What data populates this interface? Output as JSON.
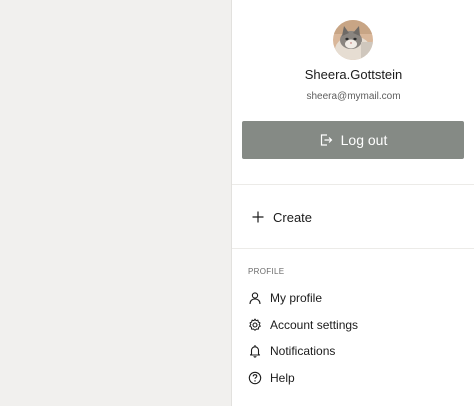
{
  "user": {
    "name": "Sheera.Gottstein",
    "email": "sheera@mymail.com",
    "avatar_icon": "cat-avatar"
  },
  "logout": {
    "label": "Log out",
    "icon": "logout-icon",
    "color": "#858a85"
  },
  "create": {
    "label": "Create",
    "icon": "plus-icon"
  },
  "profile_section": {
    "heading": "PROFILE",
    "items": [
      {
        "label": "My profile",
        "icon": "person-icon"
      },
      {
        "label": "Account settings",
        "icon": "gear-icon"
      },
      {
        "label": "Notifications",
        "icon": "bell-icon"
      },
      {
        "label": "Help",
        "icon": "help-icon"
      }
    ]
  }
}
